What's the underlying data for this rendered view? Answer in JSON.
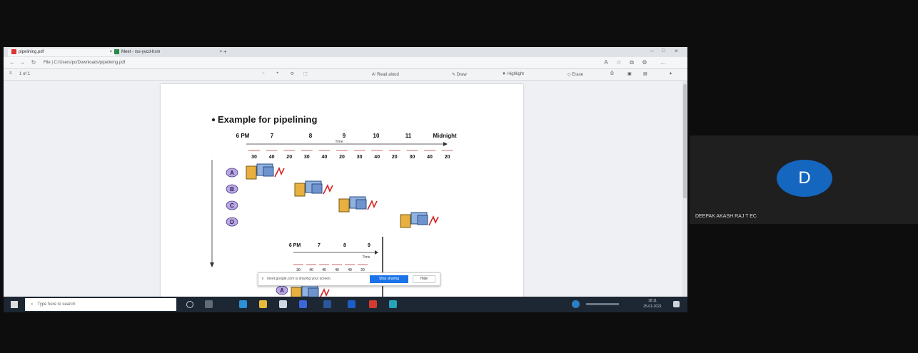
{
  "browser": {
    "tabs": [
      {
        "label": "pipelining.pdf"
      },
      {
        "label": "Meet - rss-yvcd-hsm"
      }
    ],
    "address": "File | C:/Users/pc/Downloads/pipelining.pdf",
    "pdf_toolbar": {
      "page_indicator": "1 of 1",
      "read_aloud_label": "Read aloud",
      "draw_label": "Draw",
      "highlight_label": "Highlight",
      "erase_label": "Erase"
    }
  },
  "slide": {
    "title": "Example for pipelining",
    "diagram1": {
      "time_labels": [
        "6 PM",
        "7",
        "8",
        "9",
        "10",
        "11",
        "Midnight"
      ],
      "time_axis_label": "Time",
      "durations": [
        "30",
        "40",
        "20",
        "30",
        "40",
        "20",
        "30",
        "40",
        "20",
        "30",
        "40",
        "20"
      ],
      "loads": [
        "A",
        "B",
        "C",
        "D"
      ]
    },
    "diagram2": {
      "time_labels": [
        "6 PM",
        "7",
        "8",
        "9"
      ],
      "time_axis_label": "Time",
      "durations": [
        "30",
        "40",
        "40",
        "40",
        "40",
        "20"
      ],
      "loads": [
        "A"
      ]
    }
  },
  "share_toast": {
    "message": "meet.google.com is sharing your screen.",
    "stop_label": "Stop sharing",
    "hide_label": "Hide"
  },
  "taskbar": {
    "search_placeholder": "Type here to search",
    "clock_time": "18:11",
    "clock_date": "25-01-2021"
  },
  "participant": {
    "initial": "D",
    "name": "DEEPAK AKASH RAJ T EC",
    "avatar_color": "#1466bf"
  }
}
